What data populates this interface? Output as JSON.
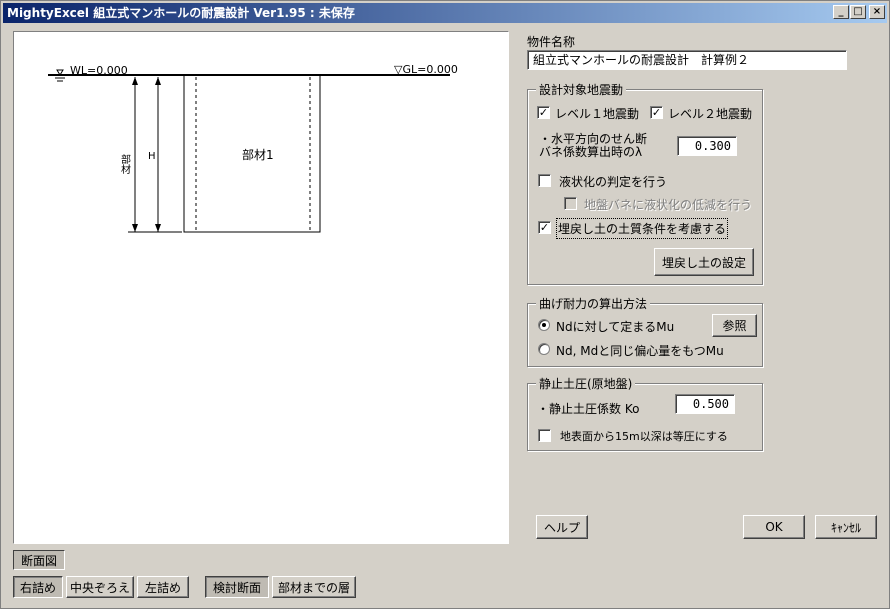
{
  "window": {
    "title": "MightyExcel 組立式マンホールの耐震設計 Ver1.95 : 未保存",
    "minimize": "_",
    "maximize": "□",
    "close": "×"
  },
  "drawing": {
    "wl_label": "WL=0.000",
    "gl_label": "▽GL=0.000",
    "dim_label_1": "部材",
    "dim_label_2": "H",
    "member_label": "部材1"
  },
  "property": {
    "label": "物件名称",
    "value": "組立式マンホールの耐震設計　計算例２"
  },
  "seismic": {
    "title": "設計対象地震動",
    "level1_label": "レベル１地震動",
    "level1_checked": true,
    "level2_label": "レベル２地震動",
    "level2_checked": true,
    "lambda_label_line1": "・水平方向のせん断",
    "lambda_label_line2": "バネ係数算出時のλ",
    "lambda_value": "0.300",
    "liquefaction_label": "液状化の判定を行う",
    "liquefaction_checked": false,
    "spring_reduce_label": "地盤バネに液状化の低減を行う",
    "spring_reduce_checked": false,
    "backfill_label": "埋戻し土の土質条件を考慮する",
    "backfill_checked": true,
    "backfill_button": "埋戻し土の設定"
  },
  "bending": {
    "title": "曲げ耐力の算出方法",
    "option1_label": "Ndに対して定まるMu",
    "option2_label": "Nd, Mdと同じ偏心量をもつMu",
    "selected": "option1",
    "ref_button": "参照"
  },
  "earth_pressure": {
    "title": "静止土圧(原地盤)",
    "ko_label": "・静止土圧係数  Ko",
    "ko_value": "0.500",
    "uniform_label": "地表面から15m以深は等圧にする",
    "uniform_checked": false
  },
  "buttons": {
    "help": "ヘルプ",
    "ok": "OK",
    "cancel": "ｷｬﾝｾﾙ"
  },
  "bottom": {
    "section_label": "断面図",
    "right_align": "右詰め",
    "center_align": "中央ぞろえ",
    "left_align": "左詰め",
    "check_section": "検討断面",
    "layers_to_member": "部材までの層"
  }
}
